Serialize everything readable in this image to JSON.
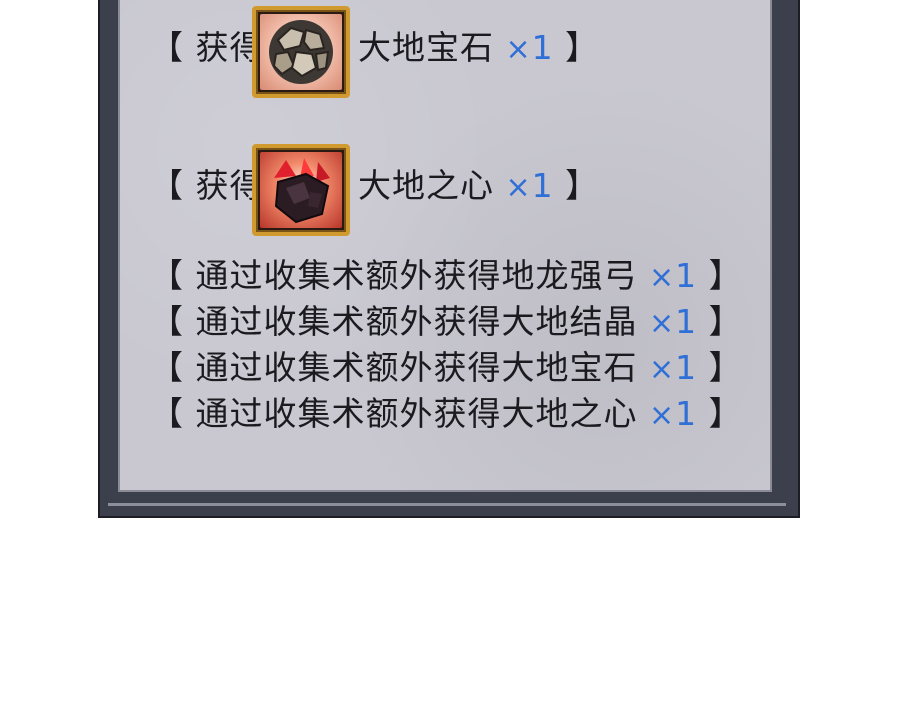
{
  "rewards": [
    {
      "prefix": "【 获得",
      "item": "大地宝石",
      "times": "×",
      "count": "1",
      "suffix": "】",
      "icon": "earth-gem-icon"
    },
    {
      "prefix": "【 获得",
      "item": "大地之心",
      "times": "×",
      "count": "1",
      "suffix": "】",
      "icon": "earth-heart-icon"
    }
  ],
  "extra_rewards": [
    {
      "text": "【 通过收集术额外获得地龙强弓",
      "times": "×",
      "count": "1",
      "suffix": "】"
    },
    {
      "text": "【 通过收集术额外获得大地结晶",
      "times": "×",
      "count": "1",
      "suffix": "】"
    },
    {
      "text": "【 通过收集术额外获得大地宝石",
      "times": "×",
      "count": "1",
      "suffix": "】"
    },
    {
      "text": "【 通过收集术额外获得大地之心",
      "times": "×",
      "count": "1",
      "suffix": "】"
    }
  ],
  "colors": {
    "quantity": "#2f6fd6",
    "panel": "#c9c8d1",
    "icon_border": "#d19a2e"
  }
}
